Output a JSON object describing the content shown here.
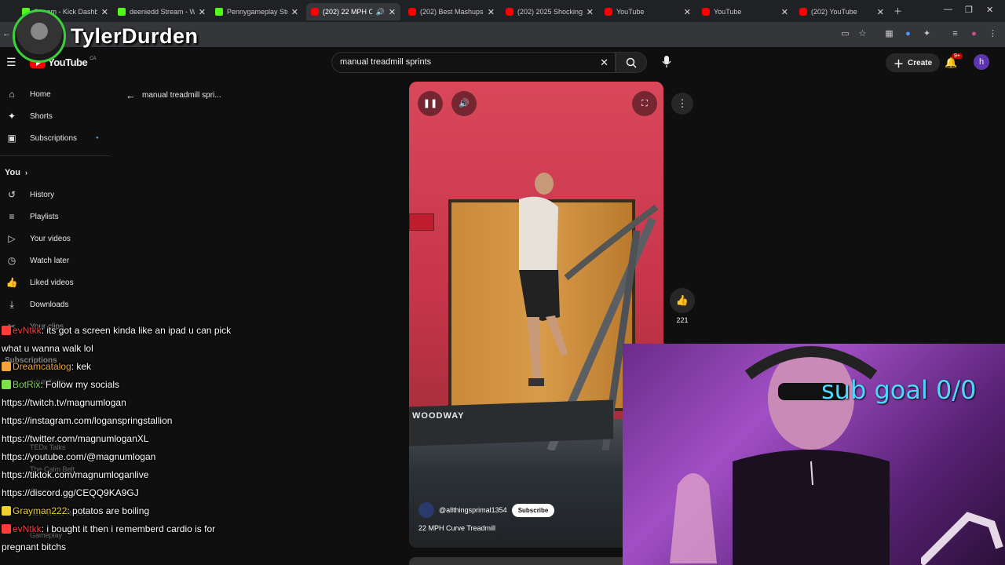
{
  "tabs": [
    {
      "title": "Stream - Kick Dashboard",
      "favicon": "kick",
      "active": false
    },
    {
      "title": "deeniedd Stream - Watch",
      "favicon": "kick",
      "active": false
    },
    {
      "title": "Pennygameplay Stream",
      "favicon": "kick",
      "active": false
    },
    {
      "title": "(202) 22 MPH Curve",
      "favicon": "youtube",
      "active": true
    },
    {
      "title": "(202) Best Mashups",
      "favicon": "youtube",
      "active": false
    },
    {
      "title": "(202) 2025 Shocking",
      "favicon": "youtube",
      "active": false
    },
    {
      "title": "YouTube",
      "favicon": "youtube",
      "active": false
    },
    {
      "title": "YouTube",
      "favicon": "youtube",
      "active": false
    },
    {
      "title": "(202) YouTube",
      "favicon": "youtube",
      "active": false
    }
  ],
  "overlay": {
    "streamer_name": "TylerDurden"
  },
  "youtube": {
    "logo_text": "YouTube",
    "region": "CA",
    "search_query": "manual treadmill sprints",
    "create_label": "Create",
    "notifications_badge": "9+",
    "account_initial": "h"
  },
  "sidebar": {
    "items": [
      {
        "label": "Home",
        "icon": "home-icon"
      },
      {
        "label": "Shorts",
        "icon": "shorts-icon"
      },
      {
        "label": "Subscriptions",
        "icon": "subscriptions-icon"
      }
    ],
    "you_label": "You",
    "you_items": [
      {
        "label": "History",
        "icon": "history-icon"
      },
      {
        "label": "Playlists",
        "icon": "playlists-icon"
      },
      {
        "label": "Your videos",
        "icon": "your-videos-icon"
      },
      {
        "label": "Watch later",
        "icon": "watch-later-icon"
      },
      {
        "label": "Liked videos",
        "icon": "liked-videos-icon"
      },
      {
        "label": "Downloads",
        "icon": "downloads-icon"
      }
    ],
    "your_clips": "Your clips",
    "subscriptions_header": "Subscriptions",
    "subscriptions_partial": [
      "Adult Swim",
      "TEDx Talks",
      "The Calm Belt",
      "Ohara",
      "New World Review",
      "Gameplay"
    ]
  },
  "back_link": "manual treadmill spri...",
  "short": {
    "channel": "@allthingsprimal1354",
    "subscribe_label": "Subscribe",
    "title": "22 MPH Curve Treadmill",
    "like_count": "221",
    "treadmill_brand": "WOODWAY"
  },
  "webcam": {
    "goal_text": "sub goal 0/0"
  },
  "chat": [
    {
      "user": "evNtkk",
      "user_color": "#ff3b3b",
      "text": ": its got a screen kinda like an ipad u can pick"
    },
    {
      "user": "",
      "user_color": "",
      "text": "what u wanna walk lol"
    },
    {
      "user": "Dreamcatalog",
      "user_color": "#f2a33a",
      "text": ": kek"
    },
    {
      "user": "BotRix",
      "user_color": "#7be04a",
      "text": ": Follow my socials"
    },
    {
      "user": "",
      "user_color": "",
      "text": "https://twitch.tv/magnumlogan"
    },
    {
      "user": "",
      "user_color": "",
      "text": "https://instagram.com/loganspringstallion"
    },
    {
      "user": "",
      "user_color": "",
      "text": "https://twitter.com/magnumloganXL"
    },
    {
      "user": "",
      "user_color": "",
      "text": "https://youtube.com/@magnumlogan"
    },
    {
      "user": "",
      "user_color": "",
      "text": "https://tiktok.com/magnumloganlive"
    },
    {
      "user": "",
      "user_color": "",
      "text": "https://discord.gg/CEQQ9KA9GJ"
    },
    {
      "user": "Grayman222",
      "user_color": "#f0d030",
      "text": ": potatos are boiling"
    },
    {
      "user": "evNtkk",
      "user_color": "#ff3b3b",
      "text": ": i bought it then i rememberd cardio is for"
    },
    {
      "user": "",
      "user_color": "",
      "text": "pregnant bitchs"
    }
  ],
  "colors": {
    "brand_red": "#ff0000",
    "kick_green": "#53fc18",
    "goal_cyan": "#4fd8ff",
    "bg": "#0f0f0f"
  }
}
